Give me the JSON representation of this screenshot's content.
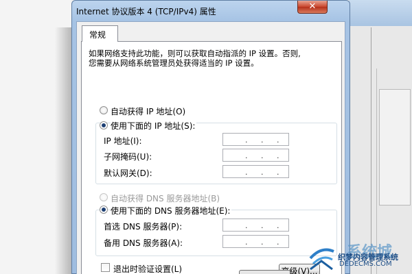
{
  "dialog": {
    "title": "Internet 协议版本 4 (TCP/IPv4) 属性",
    "close_glyph": "✕",
    "tab_label": "常规",
    "description_line1": "如果网络支持此功能，则可以获取自动指派的 IP 设置。否则,",
    "description_line2": "您需要从网络系统管理员处获得适当的 IP 设置。"
  },
  "ip_section": {
    "auto_label": "自动获得 IP 地址(O)",
    "auto_checked": false,
    "manual_label": "使用下面的 IP 地址(S):",
    "manual_checked": true,
    "fields": [
      {
        "label": "IP 地址(I):",
        "value": ""
      },
      {
        "label": "子网掩码(U):",
        "value": ""
      },
      {
        "label": "默认网关(D):",
        "value": ""
      }
    ]
  },
  "dns_section": {
    "auto_label": "自动获得 DNS 服务器地址(B)",
    "auto_enabled": false,
    "manual_label": "使用下面的 DNS 服务器地址(E):",
    "manual_checked": true,
    "fields": [
      {
        "label": "首选 DNS 服务器(P):",
        "value": ""
      },
      {
        "label": "备用 DNS 服务器(A):",
        "value": ""
      }
    ]
  },
  "footer": {
    "validate_label": "退出时验证设置(L)",
    "validate_checked": false,
    "advanced_label": "高级(V)..."
  },
  "watermark": {
    "brand": "系统城",
    "line1": "织梦内容管理系统",
    "line2": "DEDECMS.COM"
  },
  "colors": {
    "title_bar": "#a6c3e4",
    "close_button": "#c9452c",
    "radio_dot": "#1d3f73"
  }
}
